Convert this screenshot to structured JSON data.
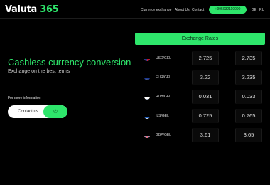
{
  "header": {
    "logo_word": "Valuta ",
    "logo_num": "365",
    "nav": [
      "Currency exchange",
      "About Us",
      "Contact"
    ],
    "phone": "+995032110090",
    "languages": [
      "GE",
      "RU"
    ]
  },
  "hero": {
    "title": "Cashless currency conversion",
    "subtitle": "Exchange on the best terms",
    "more_info": "For more information",
    "contact_label": "Contact us",
    "contact_icon": "phone-icon"
  },
  "rates": {
    "title": "Exchange Rates",
    "rows": [
      {
        "pair": "USD/GEL",
        "buy": "2.725",
        "sell": "2.735",
        "flag": "us-flag-icon"
      },
      {
        "pair": "EUR/GEL",
        "buy": "3.22",
        "sell": "3.235",
        "flag": "eu-flag-icon"
      },
      {
        "pair": "RUB/GEL",
        "buy": "0.031",
        "sell": "0.033",
        "flag": "ru-flag-icon"
      },
      {
        "pair": "ILS/GEL",
        "buy": "0.725",
        "sell": "0.765",
        "flag": "il-flag-icon"
      },
      {
        "pair": "GBP/GEL",
        "buy": "3.61",
        "sell": "3.65",
        "flag": "gb-flag-icon"
      }
    ]
  },
  "colors": {
    "accent": "#2ee66b",
    "background": "#000000"
  }
}
